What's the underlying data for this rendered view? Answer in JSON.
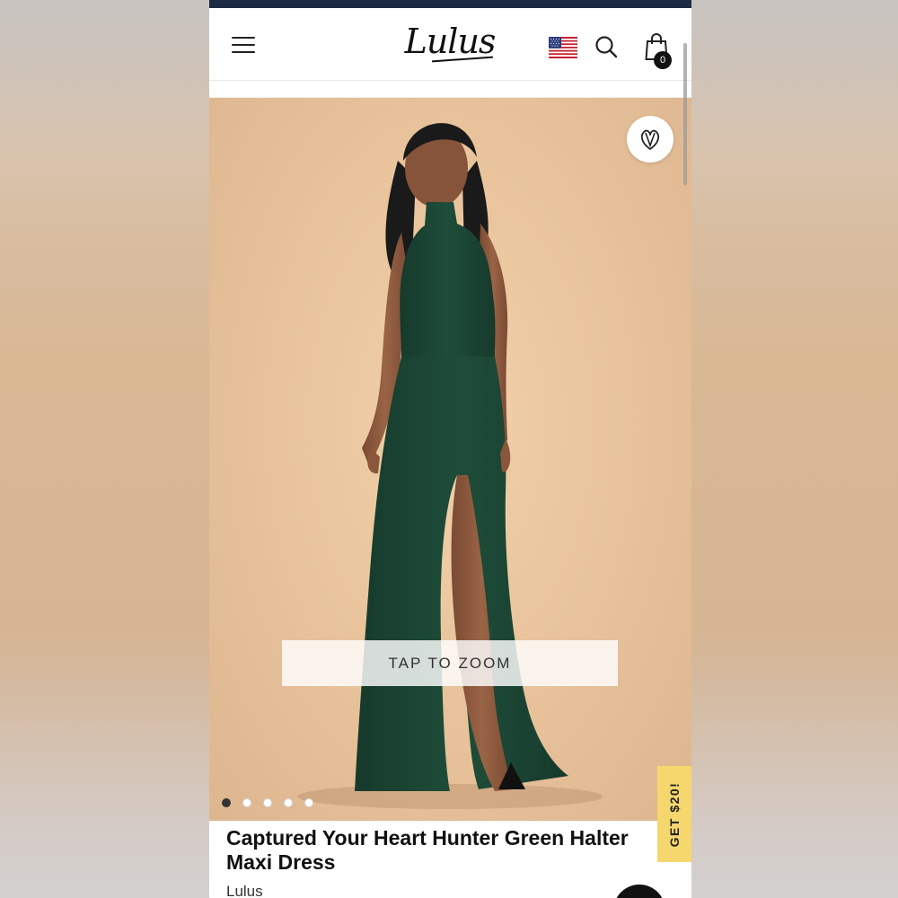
{
  "header": {
    "logo_text": "Lulus",
    "menu_icon": "hamburger-menu-icon",
    "flag_icon": "us-flag-icon",
    "search_icon": "search-icon",
    "cart_icon": "shopping-bag-icon",
    "cart_count": "0"
  },
  "product": {
    "image_overlay": "TAP TO ZOOM",
    "image_count": 5,
    "active_image_index": 1,
    "wishlist_icon": "heart-icon",
    "title": "Captured Your Heart Hunter Green Halter Maxi Dress",
    "brand": "Lulus"
  },
  "promo": {
    "label": "GET $20!",
    "color": "#f6d76e"
  },
  "colors": {
    "topbar": "#1c2a44",
    "dress": "#1e4a38",
    "backdrop": "#e9c49c"
  }
}
